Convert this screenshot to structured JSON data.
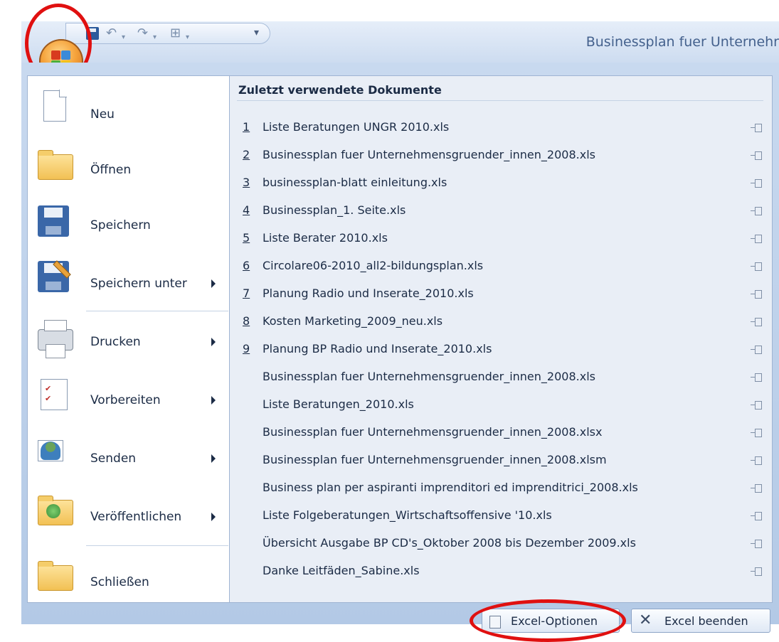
{
  "window": {
    "title": "Businessplan fuer Unternehr"
  },
  "quick_access": {
    "customize_glyph": "▾"
  },
  "office_menu": {
    "items": [
      {
        "label": "Neu",
        "icon": "new-document-icon",
        "has_submenu": false
      },
      {
        "label": "Öffnen",
        "icon": "open-folder-icon",
        "has_submenu": false
      },
      {
        "label": "Speichern",
        "icon": "save-floppy-icon",
        "has_submenu": false
      },
      {
        "label": "Speichern unter",
        "icon": "save-as-icon",
        "has_submenu": true
      },
      {
        "label": "Drucken",
        "icon": "printer-icon",
        "has_submenu": true
      },
      {
        "label": "Vorbereiten",
        "icon": "prepare-icon",
        "has_submenu": true
      },
      {
        "label": "Senden",
        "icon": "send-icon",
        "has_submenu": true
      },
      {
        "label": "Veröffentlichen",
        "icon": "publish-icon",
        "has_submenu": true
      },
      {
        "label": "Schließen",
        "icon": "close-folder-icon",
        "has_submenu": false
      }
    ]
  },
  "recent_documents": {
    "heading": "Zuletzt verwendete Dokumente",
    "items": [
      {
        "num": "1",
        "name": "Liste Beratungen UNGR 2010.xls"
      },
      {
        "num": "2",
        "name": "Businessplan fuer Unternehmensgruender_innen_2008.xls"
      },
      {
        "num": "3",
        "name": "businessplan-blatt einleitung.xls"
      },
      {
        "num": "4",
        "name": "Businessplan_1. Seite.xls"
      },
      {
        "num": "5",
        "name": "Liste Berater 2010.xls"
      },
      {
        "num": "6",
        "name": "Circolare06-2010_all2-bildungsplan.xls"
      },
      {
        "num": "7",
        "name": "Planung Radio und Inserate_2010.xls"
      },
      {
        "num": "8",
        "name": "Kosten Marketing_2009_neu.xls"
      },
      {
        "num": "9",
        "name": "Planung BP Radio und Inserate_2010.xls"
      },
      {
        "num": "",
        "name": "Businessplan fuer Unternehmensgruender_innen_2008.xls"
      },
      {
        "num": "",
        "name": "Liste Beratungen_2010.xls"
      },
      {
        "num": "",
        "name": "Businessplan fuer Unternehmensgruender_innen_2008.xlsx"
      },
      {
        "num": "",
        "name": "Businessplan fuer Unternehmensgruender_innen_2008.xlsm"
      },
      {
        "num": "",
        "name": "Business plan per aspiranti imprenditori ed imprenditrici_2008.xls"
      },
      {
        "num": "",
        "name": "Liste Folgeberatungen_Wirtschaftsoffensive '10.xls"
      },
      {
        "num": "",
        "name": "Übersicht Ausgabe BP CD's_Oktober 2008 bis Dezember 2009.xls"
      },
      {
        "num": "",
        "name": "Danke Leitfäden_Sabine.xls"
      }
    ]
  },
  "footer": {
    "options_label": "Excel-Optionen",
    "exit_label": "Excel beenden"
  },
  "colors": {
    "annotation_red": "#e01010",
    "menu_frame": "#c8d9ef",
    "recent_pane": "#e9eef6"
  }
}
